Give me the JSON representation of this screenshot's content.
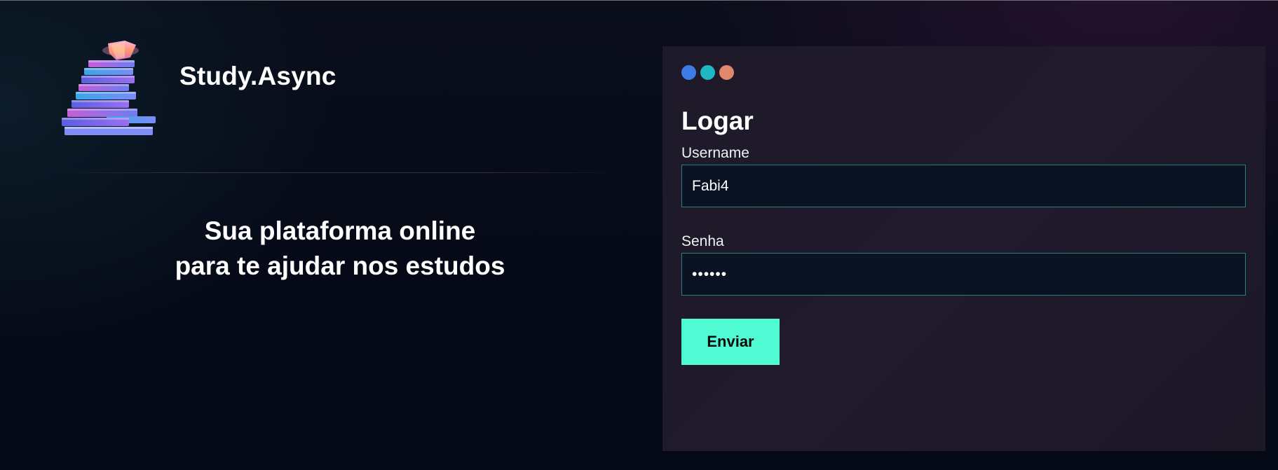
{
  "brand": {
    "name": "Study.Async",
    "logo_icon": "book-stack-icon"
  },
  "tagline": {
    "line1": "Sua plataforma online",
    "line2": "para te ajudar nos estudos"
  },
  "login": {
    "window_dots": [
      "#3f7be8",
      "#1fb7c3",
      "#e0886a"
    ],
    "title": "Logar",
    "username_label": "Username",
    "username_value": "Fabi4",
    "password_label": "Senha",
    "password_value": "••••••",
    "submit_label": "Enviar"
  },
  "colors": {
    "accent": "#50fbd3",
    "field_border": "#2c7d86",
    "field_bg": "#0b1323",
    "card_bg": "#1e1a29"
  }
}
